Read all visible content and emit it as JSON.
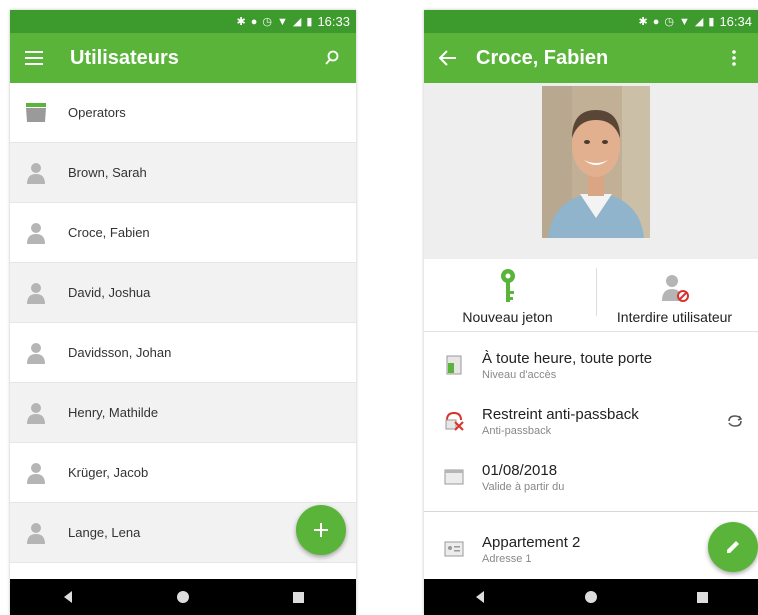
{
  "left_screen": {
    "status": {
      "time": "16:33"
    },
    "appbar": {
      "title": "Utilisateurs"
    },
    "items": [
      {
        "label": "Operators",
        "icon": "folder-icon"
      },
      {
        "label": "Brown, Sarah",
        "icon": "user-icon"
      },
      {
        "label": "Croce, Fabien",
        "icon": "user-icon"
      },
      {
        "label": "David, Joshua",
        "icon": "user-icon"
      },
      {
        "label": "Davidsson, Johan",
        "icon": "user-icon"
      },
      {
        "label": "Henry, Mathilde",
        "icon": "user-icon"
      },
      {
        "label": "Krüger, Jacob",
        "icon": "user-icon"
      },
      {
        "label": "Lange, Lena",
        "icon": "user-icon"
      }
    ]
  },
  "right_screen": {
    "status": {
      "time": "16:34"
    },
    "appbar": {
      "title": "Croce, Fabien"
    },
    "actions": {
      "new_token": "Nouveau jeton",
      "ban_user": "Interdire utilisateur"
    },
    "details": {
      "access_level": {
        "value": "À toute heure, toute porte",
        "label": "Niveau d'accès"
      },
      "anti_passback": {
        "value": "Restreint anti-passback",
        "label": "Anti-passback"
      },
      "valid_from": {
        "value": "01/08/2018",
        "label": "Valide à partir du"
      },
      "address": {
        "value": "Appartement 2",
        "label": "Adresse 1"
      }
    }
  },
  "colors": {
    "status_bar": "#3d9a2c",
    "app_bar": "#5ab43a",
    "fab": "#5ab43a",
    "key_icon": "#5ab43a"
  }
}
